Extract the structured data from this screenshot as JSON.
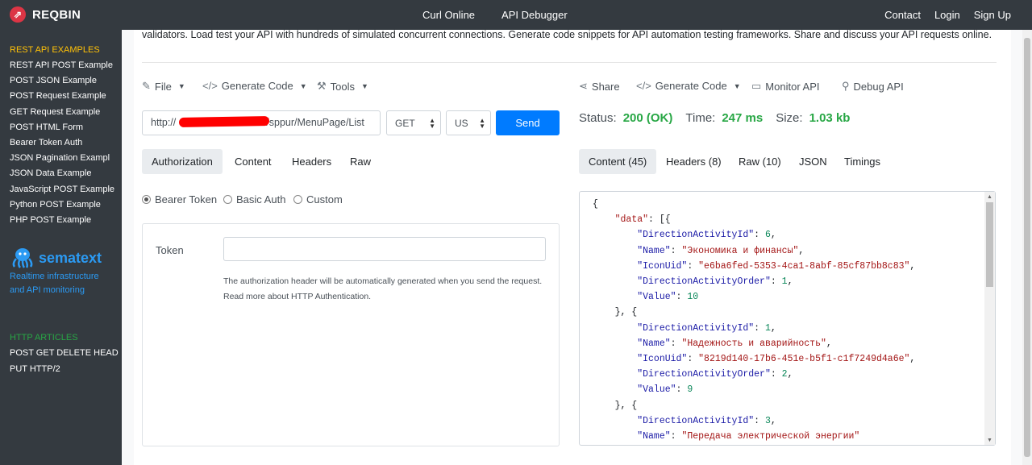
{
  "brand": {
    "name": "REQBIN",
    "logo_glyph": "⇗"
  },
  "topnav": {
    "center": [
      "Curl Online",
      "API Debugger"
    ],
    "right": [
      "Contact",
      "Login",
      "Sign Up"
    ]
  },
  "sidebar": {
    "examples_heading": "REST API EXAMPLES",
    "examples": [
      "REST API POST Example",
      "POST JSON Example",
      "POST Request Example",
      "GET Request Example",
      "POST HTML Form",
      "Bearer Token Auth",
      "JSON Pagination Exampl",
      "JSON Data Example",
      "JavaScript POST Example",
      "Python POST Example",
      "PHP POST Example"
    ],
    "sponsor_name": "sematext",
    "sponsor_tagline": "Realtime infrastructure and API monitoring",
    "articles_heading": "HTTP ARTICLES",
    "articles": [
      "POST GET DELETE HEAD",
      "PUT HTTP/2"
    ]
  },
  "intro_text": "validators. Load test your API with hundreds of simulated concurrent connections. Generate code snippets for API automation testing frameworks. Share and discuss your API requests online.",
  "request_toolbar": {
    "file": "File",
    "generate_code": "Generate Code",
    "tools": "Tools"
  },
  "response_toolbar": {
    "share": "Share",
    "generate_code": "Generate Code",
    "monitor": "Monitor API",
    "debug": "Debug API"
  },
  "request": {
    "url_prefix": "http://",
    "url_suffix": "/sppur/MenuPage/List",
    "method": "GET",
    "region": "US",
    "send_label": "Send"
  },
  "request_tabs": [
    "Authorization",
    "Content",
    "Headers",
    "Raw"
  ],
  "auth_options": [
    "Bearer Token",
    "Basic Auth",
    "Custom"
  ],
  "auth": {
    "token_label": "Token",
    "token_value": "",
    "help_line1": "The authorization header will be automatically generated when you send the request.",
    "help_line2": "Read more about HTTP Authentication."
  },
  "status": {
    "status_label": "Status:",
    "status_value": "200 (OK)",
    "time_label": "Time:",
    "time_value": "247 ms",
    "size_label": "Size:",
    "size_value": "1.03 kb"
  },
  "response_tabs": [
    "Content (45)",
    "Headers (8)",
    "Raw (10)",
    "JSON",
    "Timings"
  ],
  "response_json": {
    "root_key": "data",
    "items": [
      {
        "DirectionActivityId": 6,
        "Name": "Экономика и финансы",
        "IconUid": "e6ba6fed-5353-4ca1-8abf-85cf87bb8c83",
        "DirectionActivityOrder": 1,
        "Value": 10
      },
      {
        "DirectionActivityId": 1,
        "Name": "Надежность и аварийность",
        "IconUid": "8219d140-17b6-451e-b5f1-c1f7249d4a6e",
        "DirectionActivityOrder": 2,
        "Value": 9
      },
      {
        "DirectionActivityId": 3,
        "Name": "Передача электрической энергии"
      }
    ]
  },
  "colors": {
    "accent": "#007bff",
    "success": "#28a745",
    "sidebar_bg": "#343a40",
    "heading_yellow": "#ffc107",
    "brand_red": "#dc3545"
  }
}
